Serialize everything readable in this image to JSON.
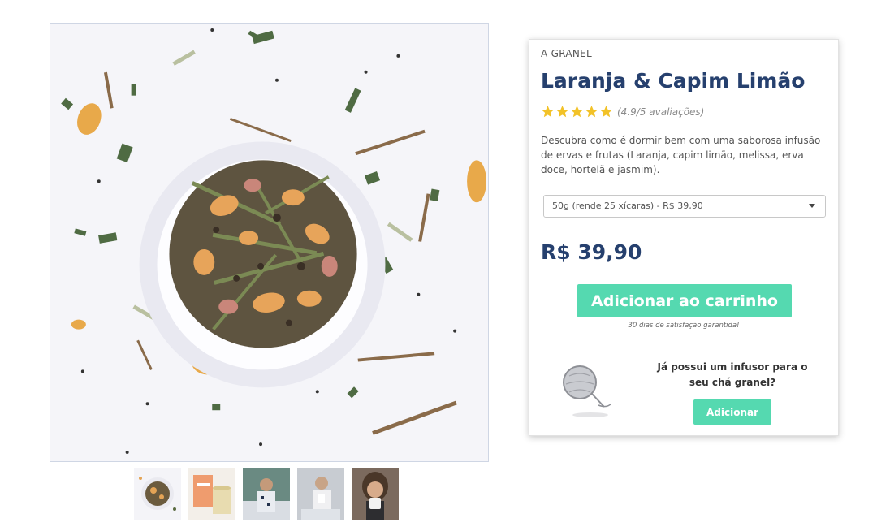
{
  "product": {
    "category": "A GRANEL",
    "title": "Laranja & Capim Limão",
    "rating": {
      "stars": 5,
      "text": "(4.9/5 avaliações)"
    },
    "description": "Descubra como é dormir bem com uma saborosa infusão de ervas e frutas (Laranja, capim limão, melissa, erva doce, hortelã e jasmim).",
    "variant": {
      "selected": "50g (rende 25 xícaras) - R$ 39,90"
    },
    "price": "R$ 39,90",
    "add_to_cart_label": "Adicionar ao carrinho",
    "guarantee": "30 dias de satisfação garantida!"
  },
  "upsell": {
    "question": "Já possui um infusor para o seu chá granel?",
    "button_label": "Adicionar"
  },
  "gallery": {
    "thumbnails": [
      "tea-bowl",
      "tea-package",
      "woman-cup",
      "woman-mug",
      "woman-drinking"
    ]
  },
  "colors": {
    "title": "#26406e",
    "accent": "#55d9b0",
    "star": "#f2c228"
  }
}
